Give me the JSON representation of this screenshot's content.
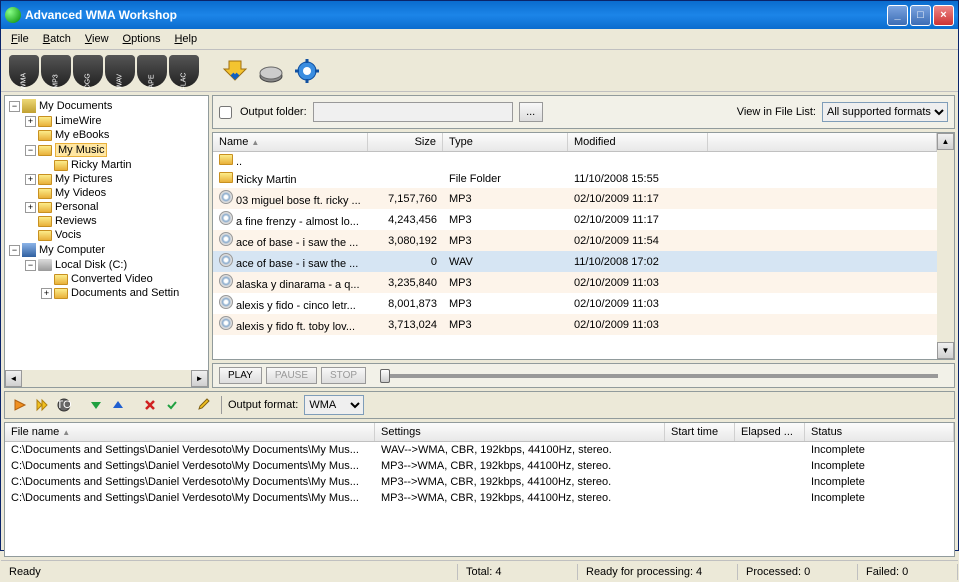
{
  "window": {
    "title": "Advanced WMA Workshop"
  },
  "menu": [
    "File",
    "Batch",
    "View",
    "Options",
    "Help"
  ],
  "formats": [
    "WMA",
    "MP3",
    "OGG",
    "WAV",
    "APE",
    "FLAC"
  ],
  "output_folder": {
    "label": "Output folder:",
    "checked": false
  },
  "view_in_list": {
    "label": "View in File List:",
    "value": "All supported formats"
  },
  "tree": [
    {
      "indent": 0,
      "exp": "-",
      "icon": "doc",
      "label": "My Documents"
    },
    {
      "indent": 1,
      "exp": "+",
      "icon": "folder",
      "label": "LimeWire"
    },
    {
      "indent": 1,
      "exp": "",
      "icon": "folder",
      "label": "My eBooks"
    },
    {
      "indent": 1,
      "exp": "-",
      "icon": "folder",
      "label": "My Music",
      "selected": true
    },
    {
      "indent": 2,
      "exp": "",
      "icon": "folder",
      "label": "Ricky Martin"
    },
    {
      "indent": 1,
      "exp": "+",
      "icon": "folder",
      "label": "My Pictures"
    },
    {
      "indent": 1,
      "exp": "",
      "icon": "folder",
      "label": "My Videos"
    },
    {
      "indent": 1,
      "exp": "+",
      "icon": "folder",
      "label": "Personal"
    },
    {
      "indent": 1,
      "exp": "",
      "icon": "folder",
      "label": "Reviews"
    },
    {
      "indent": 1,
      "exp": "",
      "icon": "folder",
      "label": "Vocis"
    },
    {
      "indent": 0,
      "exp": "-",
      "icon": "comp",
      "label": "My Computer"
    },
    {
      "indent": 1,
      "exp": "-",
      "icon": "disk",
      "label": "Local Disk (C:)"
    },
    {
      "indent": 2,
      "exp": "",
      "icon": "folder",
      "label": "Converted Video"
    },
    {
      "indent": 2,
      "exp": "+",
      "icon": "folder",
      "label": "Documents and Settin"
    }
  ],
  "columns": {
    "name": "Name",
    "size": "Size",
    "type": "Type",
    "modified": "Modified"
  },
  "files": [
    {
      "icon": "folder",
      "name": "..",
      "size": "",
      "type": "",
      "modified": ""
    },
    {
      "icon": "folder",
      "name": "Ricky Martin",
      "size": "",
      "type": "File Folder",
      "modified": "11/10/2008 15:55"
    },
    {
      "icon": "cd",
      "name": "03 miguel bose ft. ricky ...",
      "size": "7,157,760",
      "type": "MP3",
      "modified": "02/10/2009 11:17",
      "alt": true
    },
    {
      "icon": "cd",
      "name": "a fine frenzy - almost lo...",
      "size": "4,243,456",
      "type": "MP3",
      "modified": "02/10/2009 11:17"
    },
    {
      "icon": "cd",
      "name": "ace of base - i saw the ...",
      "size": "3,080,192",
      "type": "MP3",
      "modified": "02/10/2009 11:54",
      "alt": true
    },
    {
      "icon": "cd",
      "name": "ace of base - i saw the ...",
      "size": "0",
      "type": "WAV",
      "modified": "11/10/2008 17:02",
      "sel": true
    },
    {
      "icon": "cd",
      "name": "alaska y dinarama - a q...",
      "size": "3,235,840",
      "type": "MP3",
      "modified": "02/10/2009 11:03",
      "alt": true
    },
    {
      "icon": "cd",
      "name": "alexis y fido - cinco letr...",
      "size": "8,001,873",
      "type": "MP3",
      "modified": "02/10/2009 11:03"
    },
    {
      "icon": "cd",
      "name": "alexis y fido ft. toby lov...",
      "size": "3,713,024",
      "type": "MP3",
      "modified": "02/10/2009 11:03",
      "alt": true
    }
  ],
  "playback": {
    "play": "PLAY",
    "pause": "PAUSE",
    "stop": "STOP"
  },
  "output_format": {
    "label": "Output format:",
    "value": "WMA"
  },
  "queue_columns": {
    "file": "File name",
    "settings": "Settings",
    "start": "Start time",
    "elapsed": "Elapsed ...",
    "status": "Status"
  },
  "queue": [
    {
      "file": "C:\\Documents and Settings\\Daniel Verdesoto\\My Documents\\My Mus...",
      "settings": "WAV-->WMA, CBR, 192kbps, 44100Hz, stereo.",
      "start": "",
      "elapsed": "",
      "status": "Incomplete"
    },
    {
      "file": "C:\\Documents and Settings\\Daniel Verdesoto\\My Documents\\My Mus...",
      "settings": "MP3-->WMA, CBR, 192kbps, 44100Hz, stereo.",
      "start": "",
      "elapsed": "",
      "status": "Incomplete"
    },
    {
      "file": "C:\\Documents and Settings\\Daniel Verdesoto\\My Documents\\My Mus...",
      "settings": "MP3-->WMA, CBR, 192kbps, 44100Hz, stereo.",
      "start": "",
      "elapsed": "",
      "status": "Incomplete"
    },
    {
      "file": "C:\\Documents and Settings\\Daniel Verdesoto\\My Documents\\My Mus...",
      "settings": "MP3-->WMA, CBR, 192kbps, 44100Hz, stereo.",
      "start": "",
      "elapsed": "",
      "status": "Incomplete"
    }
  ],
  "status": {
    "ready": "Ready",
    "total": "Total: 4",
    "ready_proc": "Ready for processing: 4",
    "processed": "Processed: 0",
    "failed": "Failed: 0"
  }
}
